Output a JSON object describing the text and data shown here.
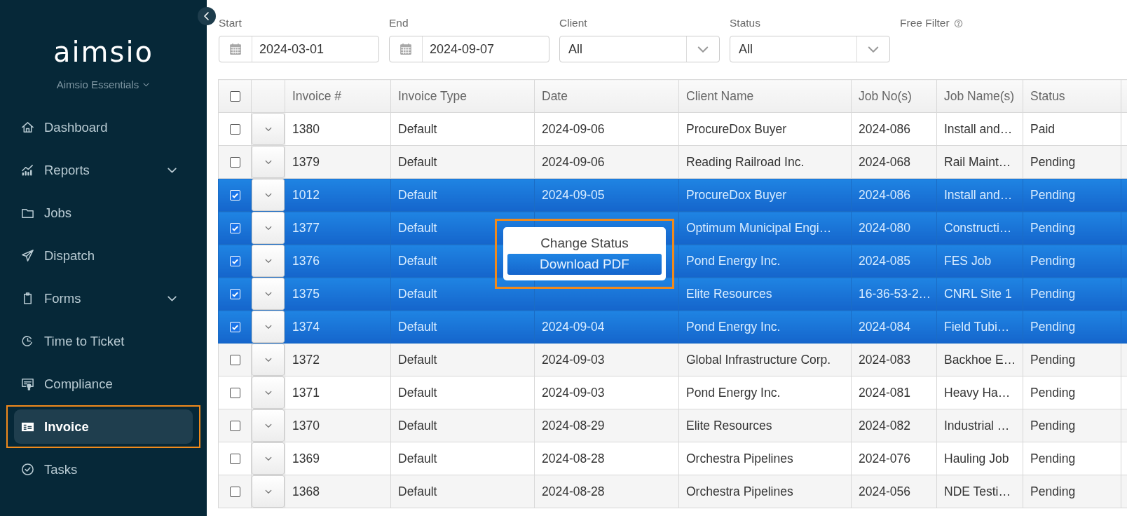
{
  "sidebar": {
    "logo": "aimsio",
    "workspace": "Aimsio Essentials",
    "items": [
      {
        "label": "Dashboard",
        "selected": false,
        "has_submenu": false,
        "highlighted": false
      },
      {
        "label": "Reports",
        "selected": false,
        "has_submenu": true,
        "highlighted": false
      },
      {
        "label": "Jobs",
        "selected": false,
        "has_submenu": false,
        "highlighted": false
      },
      {
        "label": "Dispatch",
        "selected": false,
        "has_submenu": false,
        "highlighted": false
      },
      {
        "label": "Forms",
        "selected": false,
        "has_submenu": true,
        "highlighted": false
      },
      {
        "label": "Time to Ticket",
        "selected": false,
        "has_submenu": false,
        "highlighted": false
      },
      {
        "label": "Compliance",
        "selected": false,
        "has_submenu": false,
        "highlighted": false
      },
      {
        "label": "Invoice",
        "selected": true,
        "has_submenu": false,
        "highlighted": true
      },
      {
        "label": "Tasks",
        "selected": false,
        "has_submenu": false,
        "highlighted": false
      }
    ]
  },
  "filters": [
    {
      "kind": "date",
      "label": "Start",
      "value": "2024-03-01"
    },
    {
      "kind": "date",
      "label": "End",
      "value": "2024-09-07"
    },
    {
      "kind": "select",
      "label": "Client",
      "value": "All"
    },
    {
      "kind": "select",
      "label": "Status",
      "value": "All"
    },
    {
      "kind": "text",
      "label": "Free Filter",
      "help": true
    }
  ],
  "table": {
    "header_checked": false,
    "columns": [
      "Invoice #",
      "Invoice Type",
      "Date",
      "Client Name",
      "Job No(s)",
      "Job Name(s)",
      "Status"
    ],
    "rows": [
      {
        "checked": false,
        "cells": [
          "1380",
          "Default",
          "2024-09-06",
          "ProcureDox Buyer",
          "2024-086",
          "Install and…",
          "Paid"
        ]
      },
      {
        "checked": false,
        "cells": [
          "1379",
          "Default",
          "2024-09-06",
          "Reading Railroad Inc.",
          "2024-068",
          "Rail Maint…",
          "Pending"
        ]
      },
      {
        "checked": true,
        "cells": [
          "1012",
          "Default",
          "2024-09-05",
          "ProcureDox Buyer",
          "2024-086",
          "Install and…",
          "Pending"
        ]
      },
      {
        "checked": true,
        "cells": [
          "1377",
          "Default",
          null,
          "Optimum Municipal Engi…",
          "2024-080",
          "Constructi…",
          "Pending"
        ]
      },
      {
        "checked": true,
        "cells": [
          "1376",
          "Default",
          null,
          "Pond Energy Inc.",
          "2024-085",
          "FES Job",
          "Pending"
        ]
      },
      {
        "checked": true,
        "cells": [
          "1375",
          "Default",
          null,
          "Elite Resources",
          "16-36-53-2…",
          "CNRL Site 1",
          "Pending"
        ]
      },
      {
        "checked": true,
        "cells": [
          "1374",
          "Default",
          "2024-09-04",
          "Pond Energy Inc.",
          "2024-084",
          "Field Tubi…",
          "Pending"
        ]
      },
      {
        "checked": false,
        "cells": [
          "1372",
          "Default",
          "2024-09-03",
          "Global Infrastructure Corp.",
          "2024-083",
          "Backhoe E…",
          "Pending"
        ]
      },
      {
        "checked": false,
        "cells": [
          "1371",
          "Default",
          "2024-09-03",
          "Pond Energy Inc.",
          "2024-081",
          "Heavy Ha…",
          "Pending"
        ]
      },
      {
        "checked": false,
        "cells": [
          "1370",
          "Default",
          "2024-08-29",
          "Elite Resources",
          "2024-082",
          "Industrial …",
          "Pending"
        ]
      },
      {
        "checked": false,
        "cells": [
          "1369",
          "Default",
          "2024-08-28",
          "Orchestra Pipelines",
          "2024-076",
          "Hauling Job",
          "Pending"
        ]
      },
      {
        "checked": false,
        "cells": [
          "1368",
          "Default",
          "2024-08-28",
          "Orchestra Pipelines",
          "2024-056",
          "NDE Testi…",
          "Pending"
        ]
      }
    ]
  },
  "context_menu": {
    "highlighted": true,
    "items": [
      {
        "label": "Change Status",
        "selected": false
      },
      {
        "label": "Download PDF",
        "selected": true
      }
    ]
  }
}
